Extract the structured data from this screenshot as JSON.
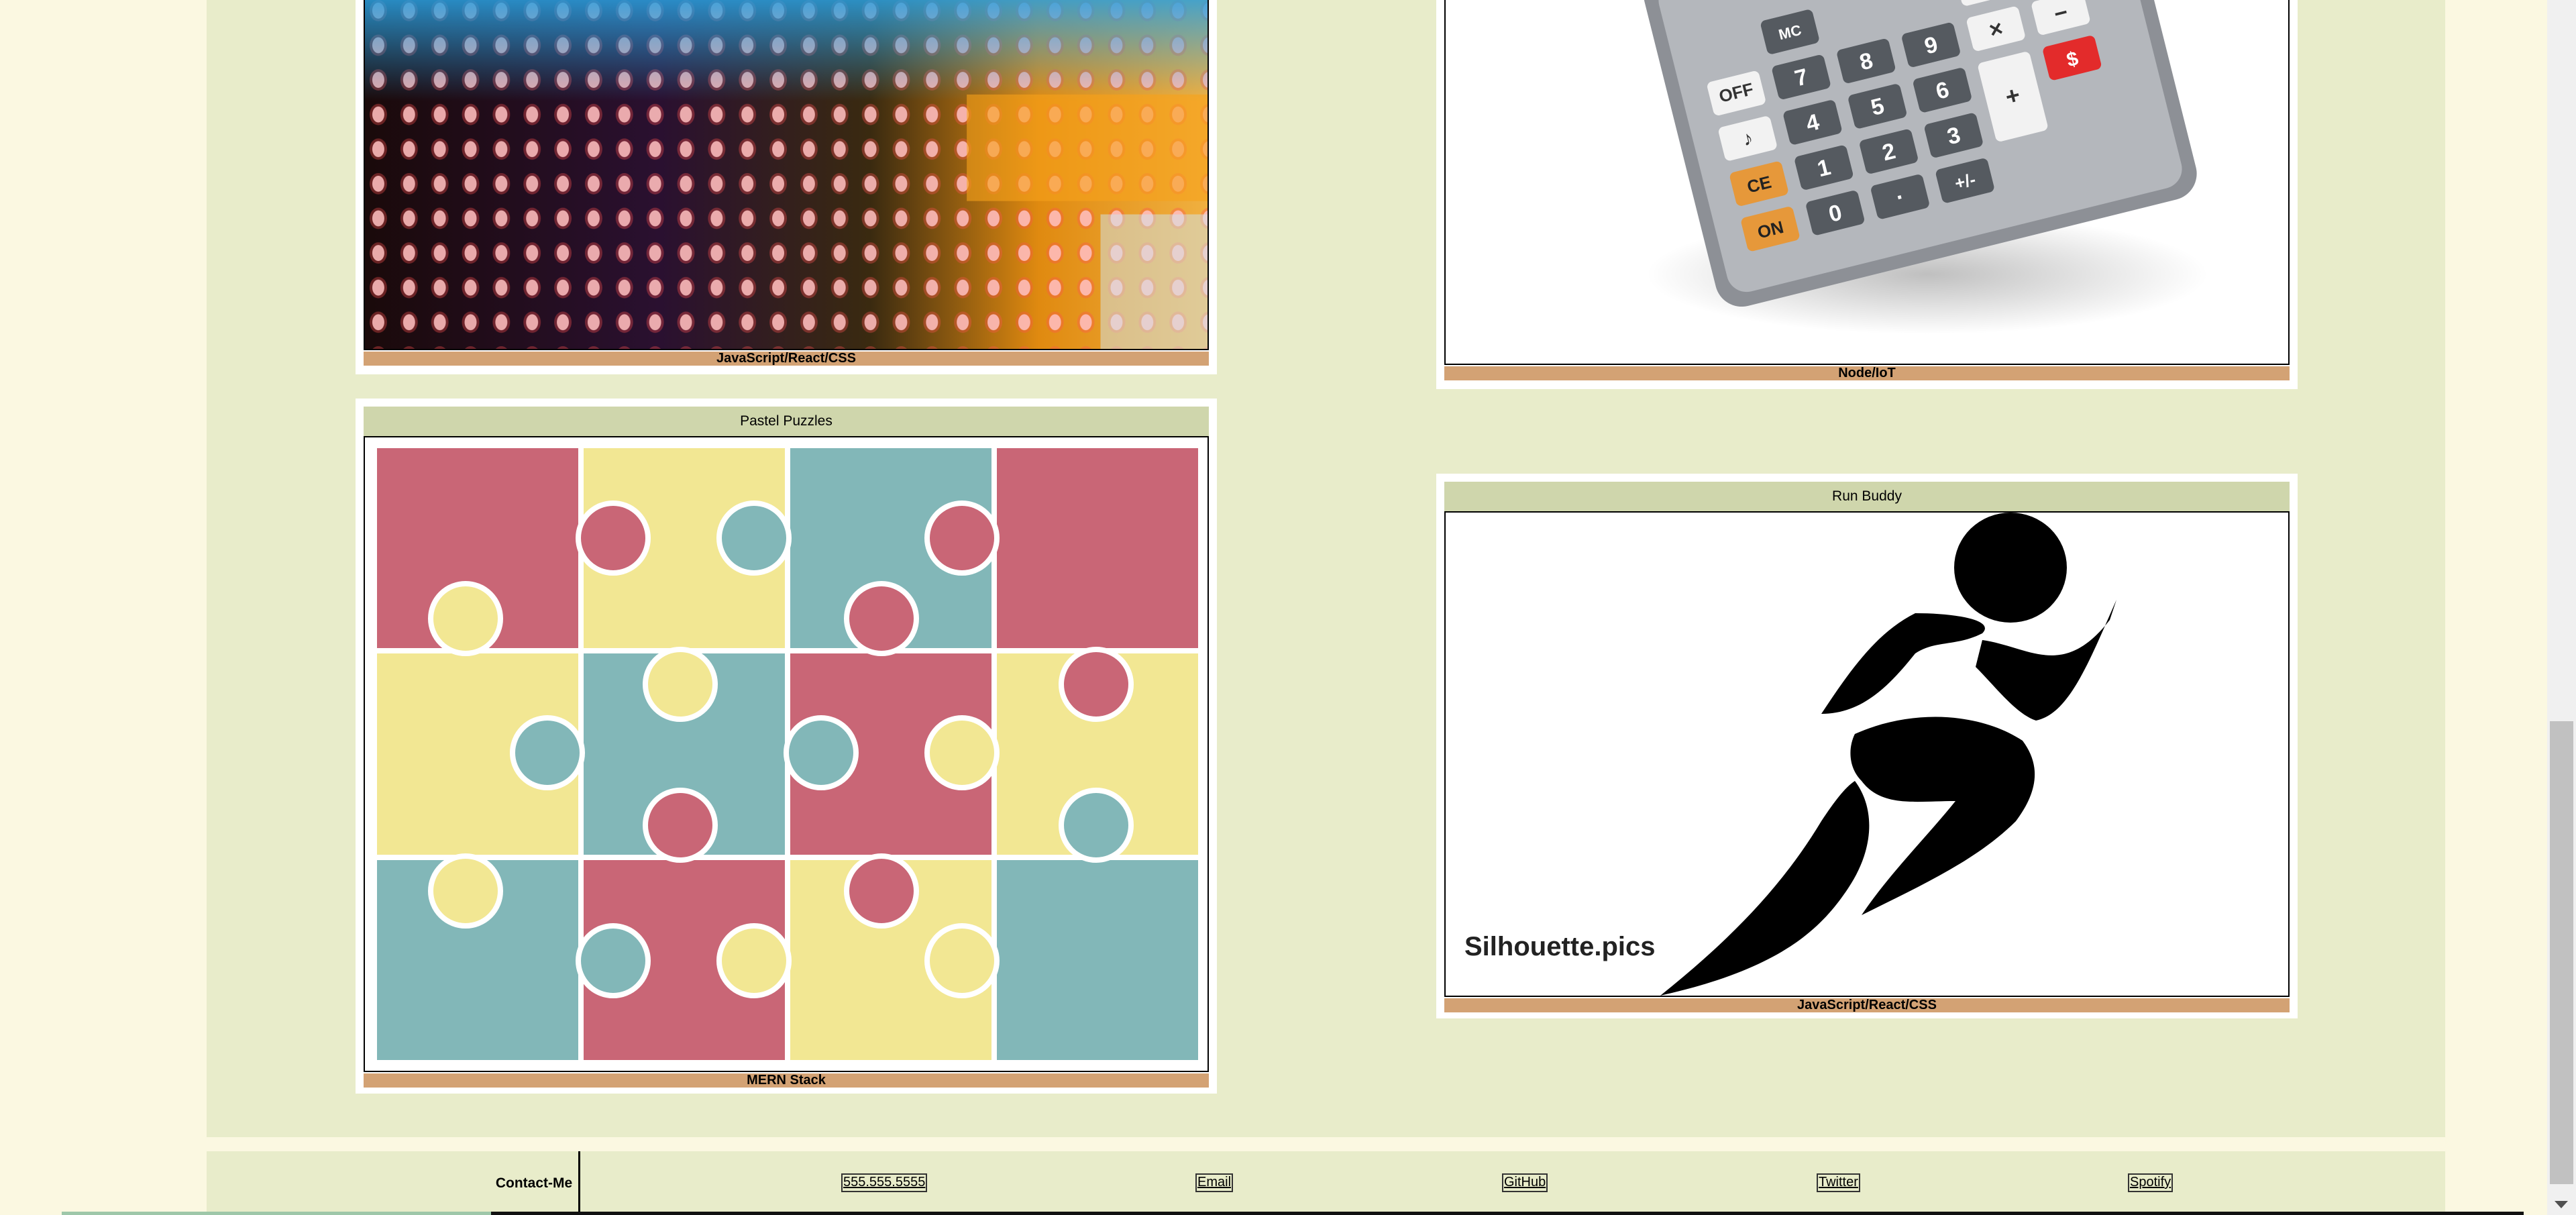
{
  "projects": [
    {
      "title": "",
      "tag": "JavaScript/React/CSS",
      "image": "led-display-image"
    },
    {
      "title": "",
      "tag": "Node/IoT",
      "image": "calculator-image"
    },
    {
      "title": "Pastel Puzzles",
      "tag": "MERN Stack",
      "image": "puzzle-pieces-image"
    },
    {
      "title": "Run Buddy",
      "tag": "JavaScript/React/CSS",
      "image": "runner-silhouette-image",
      "watermark": "Silhouette.pics"
    }
  ],
  "calculator_keys": {
    "off": "OFF",
    "note": "♪",
    "ce": "CE",
    "on": "ON",
    "k7": "7",
    "k8": "8",
    "k9": "9",
    "k4": "4",
    "k5": "5",
    "k6": "6",
    "k1": "1",
    "k2": "2",
    "k3": "3",
    "k0": "0",
    "dot": "·",
    "plus": "+",
    "plusminus": "+/-",
    "minus": "−",
    "times": "×",
    "div": "÷",
    "dollar": "$",
    "mc": "MC",
    "pct": "%"
  },
  "footer": {
    "contact_label": "Contact-Me",
    "links": [
      {
        "label": "555.555.5555"
      },
      {
        "label": "Email"
      },
      {
        "label": "GitHub"
      },
      {
        "label": "Twitter"
      },
      {
        "label": "Spotify"
      }
    ]
  },
  "colors": {
    "page_bg": "#fbf8e1",
    "panel_bg": "#e8ecca",
    "title_bar": "#cfd6ac",
    "tag_bar": "#d3a274",
    "puzzle_pink": "#c96676",
    "puzzle_yellow": "#f2e793",
    "puzzle_teal": "#82b7b8"
  }
}
